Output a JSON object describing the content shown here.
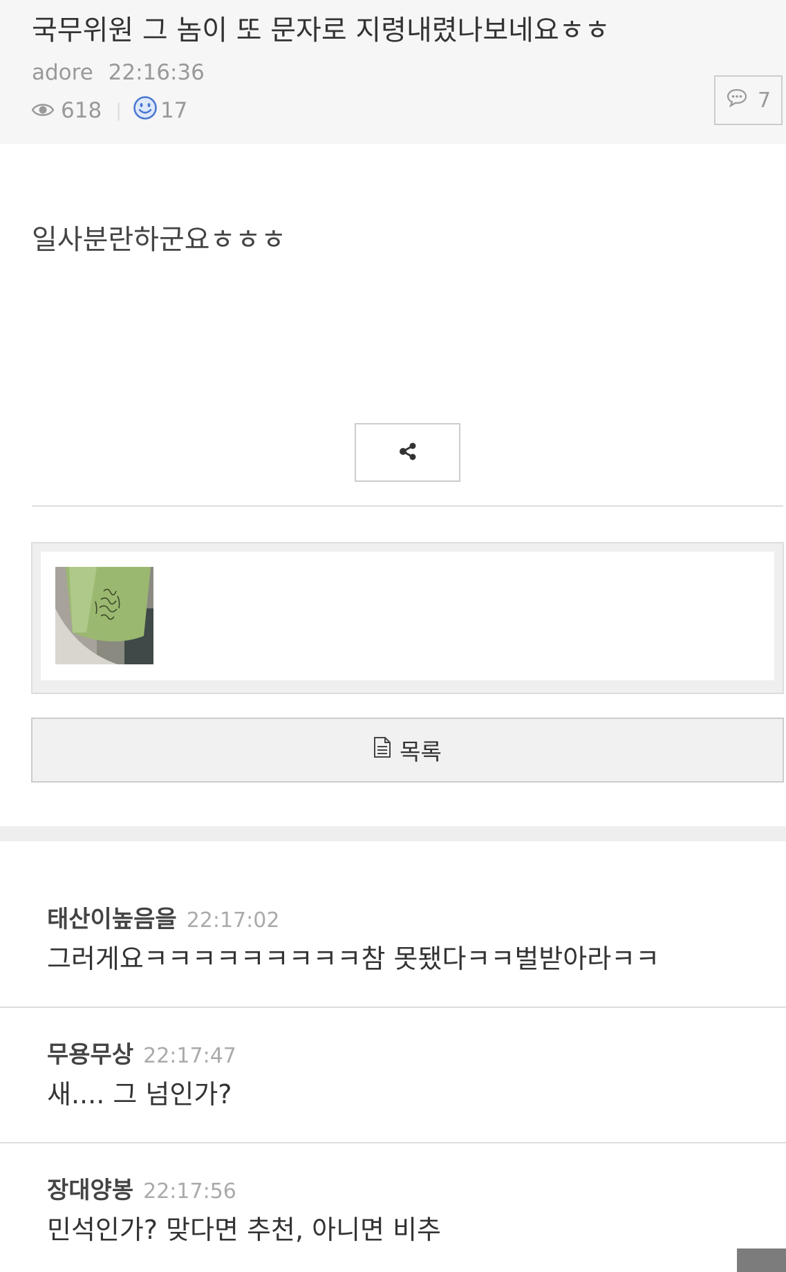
{
  "post": {
    "title": "국무위원 그 놈이 또 문자로 지령내렸나보네요ㅎㅎ",
    "author": "adore",
    "time": "22:16:36",
    "views": "618",
    "likes": "17",
    "comment_count": "7",
    "body": "일사분란하군요ㅎㅎㅎ"
  },
  "buttons": {
    "list_label": "목록"
  },
  "colors": {
    "header_bg": "#f6f6f6",
    "like_icon": "#4a78d0",
    "meta_text": "#999999"
  },
  "comments": [
    {
      "author": "태산이높음을",
      "time": "22:17:02",
      "text": "그러게요ㅋㅋㅋㅋㅋㅋㅋㅋㅋ참 못됐다ㅋㅋ벌받아라ㅋㅋ"
    },
    {
      "author": "무용무상",
      "time": "22:17:47",
      "text": "새.... 그 넘인가?"
    },
    {
      "author": "장대양봉",
      "time": "22:17:56",
      "text": "민석인가? 맞다면 추천, 아니면 비추"
    }
  ]
}
